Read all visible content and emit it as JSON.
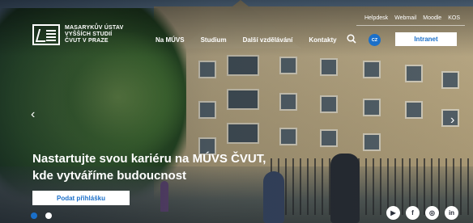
{
  "logo": {
    "lines": [
      "MASARYKŮV ÚSTAV",
      "VYŠŠÍCH STUDIÍ",
      "ČVUT V PRAZE"
    ]
  },
  "utility_links": [
    "Helpdesk",
    "Webmail",
    "Moodle",
    "KOS"
  ],
  "nav": [
    "Na MÚVS",
    "Studium",
    "Další vzdělávání",
    "Kontakty"
  ],
  "language": "CZ",
  "intranet_label": "Intranet",
  "hero": {
    "headline_line1": "Nastartujte svou kariéru na MÚVS ČVUT,",
    "headline_line2": "kde vytváříme budoucnost",
    "cta_label": "Podat přihlášku"
  },
  "carousel": {
    "slides": 2,
    "active_index": 0
  },
  "arrows": {
    "prev": "‹",
    "next": "›"
  },
  "social": [
    {
      "icon": "youtube-icon",
      "glyph": "▶"
    },
    {
      "icon": "facebook-icon",
      "glyph": "f"
    },
    {
      "icon": "instagram-icon",
      "glyph": "◎"
    },
    {
      "icon": "linkedin-icon",
      "glyph": "in"
    }
  ],
  "colors": {
    "accent": "#1a6fc9"
  }
}
